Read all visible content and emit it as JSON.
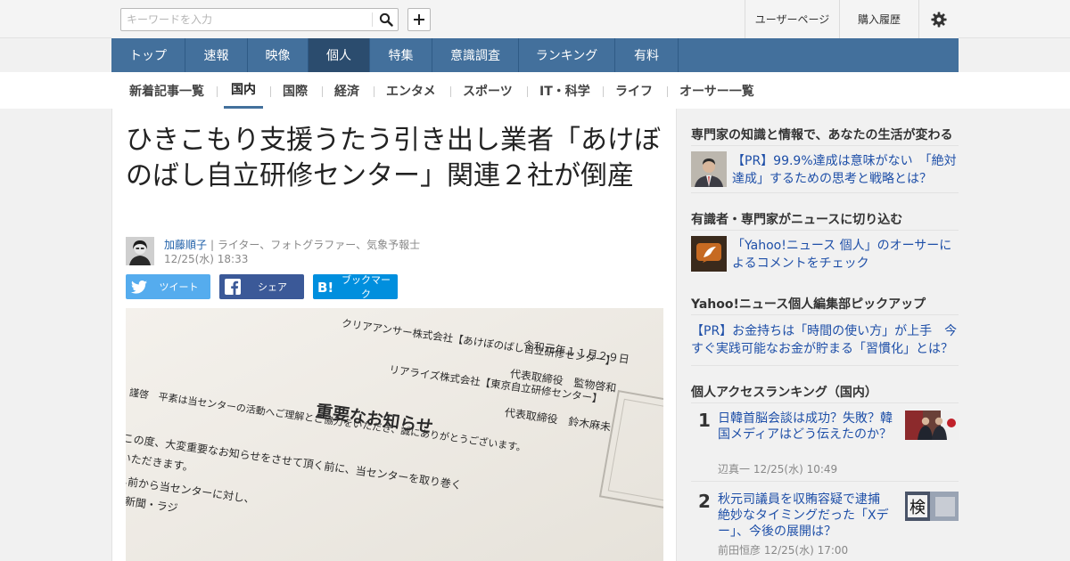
{
  "search": {
    "placeholder": "キーワードを入力"
  },
  "topnav": {
    "user_page": "ユーザーページ",
    "purchase_history": "購入履歴"
  },
  "mainnav": {
    "items": [
      "トップ",
      "速報",
      "映像",
      "個人",
      "特集",
      "意識調査",
      "ランキング",
      "有料"
    ],
    "active": "個人"
  },
  "subnav": {
    "items": [
      "新着記事一覧",
      "国内",
      "国際",
      "経済",
      "エンタメ",
      "スポーツ",
      "IT・科学",
      "ライフ",
      "オーサー一覧"
    ],
    "active": "国内"
  },
  "article": {
    "title": "ひきこもり支援うたう引き出し業者「あけぼのばし自立研修センター」関連２社が倒産",
    "author_name": "加藤順子",
    "author_role": "| ライター、フォトグラファー、気象予報士",
    "published": "12/25(水) 18:33",
    "share": {
      "twitter": "ツイート",
      "facebook": "シェア",
      "hatena": "ブックマーク"
    },
    "photo_text": {
      "date": "令和元年１１月２９日",
      "company1": "クリアアンサー株式会社【あけぼのばし自立研修センター】",
      "rep1": "代表取締役　監物啓和",
      "company2": "リアライズ株式会社【東京自立研修センター】",
      "rep2": "代表取締役　鈴木麻未",
      "heading": "重要なお知らせ",
      "line1": "謹啓　平素は当センターの活動へご理解とご協力をいただき、誠にありがとうございます。",
      "line2": "この度、大変重要なお知らせをさせて頂く前に、当センターを取り巻く",
      "line3": "いただきます。",
      "line4": "し前から当センターに対し、",
      "line5": "・新聞・ラジ"
    }
  },
  "sidebar": {
    "sec1": {
      "title": "専門家の知識と情報で、あなたの生活が変わる",
      "pr": "【PR】99.9%達成は意味がない　「絶対達成」するための思考と戦略とは？"
    },
    "sec2": {
      "title": "有識者・専門家がニュースに切り込む",
      "text": "「Yahoo!ニュース 個人」のオーサーによるコメントをチェック"
    },
    "sec3": {
      "title": "Yahoo!ニュース個人編集部ピックアップ",
      "text": "【PR】お金持ちは「時間の使い方」が上手　今すぐ実践可能なお金が貯まる「習慣化」とは？"
    },
    "ranking": {
      "title": "個人アクセスランキング（国内）",
      "items": [
        {
          "rank": "1",
          "title": "日韓首脳会談は成功？失敗？韓国メディアはどう伝えたのか？",
          "author": "辺真一",
          "time": "12/25(水) 10:49"
        },
        {
          "rank": "2",
          "title": "秋元司議員を収賄容疑で逮捕　絶妙なタイミングだった「Xデー」、今後の展開は？",
          "author": "前田恒彦",
          "time": "12/25(水) 17:00"
        }
      ]
    }
  },
  "colors": {
    "nav": "#43709c",
    "nav_active": "#2b4c6e",
    "link": "#1e4fa8",
    "twitter": "#55acee",
    "facebook": "#3b5998",
    "hatena": "#008fde"
  }
}
